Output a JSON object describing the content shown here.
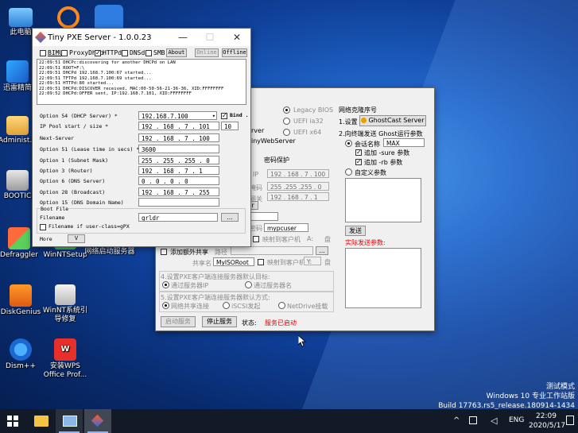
{
  "desktop": {
    "icons": [
      {
        "label": "此电脑"
      },
      {
        "label": "迅雷精简"
      },
      {
        "label": "Administ..."
      },
      {
        "label": "BOOTIC"
      },
      {
        "label": "Defraggler"
      },
      {
        "label": "WinNTSetup"
      },
      {
        "label": "网络启动服务器"
      },
      {
        "label": "DiskGenius"
      },
      {
        "label": "WinNT系统引导修复"
      },
      {
        "label": "Dism++"
      },
      {
        "label": "安装WPS Office Prof..."
      }
    ],
    "watermark": {
      "line1": "测试模式",
      "line2": "Windows 10 专业工作站版",
      "line3": "Build 17763.rs5_release.180914-1434"
    }
  },
  "back_window": {
    "boot_options": [
      "Legacy BIOS",
      "UEFI ia32",
      "UEFI x64"
    ],
    "server_label": "rver",
    "web_server_label": "inyWebServer",
    "net_boot_title": "网络克隆序号",
    "step1": "1.设置",
    "ghostcast_btn": "GhostCast Server",
    "step2": "2.向终端发送 Ghost运行参数",
    "session_name_label": "会话名称",
    "session_name_value": "MAX",
    "append_sure": "追加 -sure 参数",
    "append_rb": "追加 -rb 参数",
    "custom_params": "自定义参数",
    "send_btn": "发送",
    "actual_params": "实际发送参数:",
    "password_protect": "密码保护",
    "ip_label": "IP",
    "ip_value": "192 . 168 . 7 . 100",
    "mask_label": "掩码",
    "mask_value": "255 .255 .255 . 0",
    "gateway_label": "网关",
    "gateway_value": "192 . 168 . 7 . 1",
    "r_btn": "r",
    "pwd_label": "密码",
    "pwd_value": "mypcuser",
    "map_label1": "映射到客户机",
    "map_sel1": "A:",
    "disk1": "盘",
    "add_share": "添加额外共享",
    "path_label": "路径",
    "path_btn": "...",
    "share_name_label": "共享名",
    "share_name_value": "MyISORoot",
    "map_label2": "映射到客户机",
    "map_sel2": "Y:",
    "disk2": "盘",
    "section4": "4.设置PXE客户端连接服务器默认目标:",
    "opt_ip": "通过服务器IP",
    "opt_name": "通过服务器名",
    "section5": "5.设置PXE客户端连接服务器默认方式:",
    "opt_share": "网络共享连接",
    "opt_iscsi": "iSCSI发起",
    "opt_netdrive": "NetDrive挂载",
    "start_btn": "启动服务",
    "stop_btn": "停止服务",
    "status_label": "状态:",
    "status_value": "服务已启动"
  },
  "pxe_window": {
    "title": "Tiny PXE Server - 1.0.0.23",
    "toolbar": {
      "bimu": "BIMU",
      "proxydhcp": "ProxyDhcp",
      "httpd": "HTTPd",
      "dnsd": "DNSd",
      "smb": "SMB",
      "about": "About",
      "online": "Online",
      "offline": "Offline"
    },
    "log": [
      "22:09:51 DHCPc:discovering for another DHCPd on LAN",
      "22:09:51 ROOT=F:\\",
      "22:09:51 DHCPd 192.168.7.100:67 started...",
      "22:09:51 TFTPd 192.168.7.100:69 started...",
      "22:09:51 HTTPd:80 started...",
      "22:09:51 DHCPd:DISCOVER received, MAC:00-50-56-21-36-36, XID:FFFFFFFF",
      "22:09:52 DHCPd:OFFER sent, IP:192.168.7.101, XID:FFFFFFFF"
    ],
    "rows": [
      {
        "label": "Option 54 (DHCP Server) *",
        "value": "192.168.7.100"
      },
      {
        "label": "IP Pool start / size *",
        "value": "192 . 168 . 7 . 101"
      },
      {
        "label": "Next-Server",
        "value": "192 . 168 . 7 . 100"
      },
      {
        "label": "Option 51 (Lease time in secs) *",
        "value": "3600"
      },
      {
        "label": "Option 1  (Subnet Mask)",
        "value": "255 . 255 . 255 . 0"
      },
      {
        "label": "Option 3  (Router)",
        "value": "192 . 168 . 7 . 1"
      },
      {
        "label": "Option 6  (DNS Server)",
        "value": "0 . 0 . 0 . 0"
      },
      {
        "label": "Option 28 (Broadcast)",
        "value": "192 . 168 . 7 . 255"
      },
      {
        "label": "Option 15 (DNS Domain Name)",
        "value": ""
      }
    ],
    "pool_size": "10",
    "bind_label": "Bind .",
    "boot_file_group": "Boot File",
    "filename_label": "Filename",
    "filename_value": "grldr",
    "browse_btn": "...",
    "user_class_label": "Filename if user-class=gPX",
    "more_label": "More",
    "more_btn": "V"
  },
  "taskbar": {
    "time": "22:09",
    "date": "2020/5/17",
    "lang": "ENG"
  }
}
